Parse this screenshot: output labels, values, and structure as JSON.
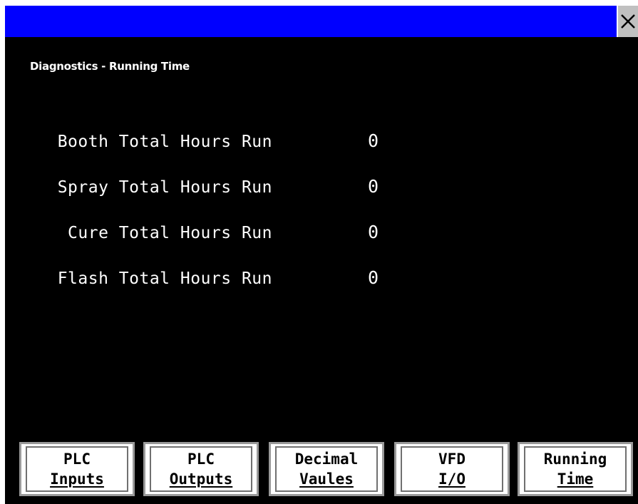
{
  "screen": {
    "title": "Diagnostics - Running Time",
    "close_label": "X"
  },
  "rows": [
    {
      "label": "Booth Total Hours Run",
      "value": "0"
    },
    {
      "label": "Spray Total Hours Run",
      "value": "0"
    },
    {
      "label": "Cure Total Hours Run",
      "value": "0"
    },
    {
      "label": "Flash Total Hours Run",
      "value": "0"
    }
  ],
  "nav": [
    {
      "line1": "PLC",
      "line2": "Inputs"
    },
    {
      "line1": "PLC",
      "line2": "Outputs"
    },
    {
      "line1": "Decimal",
      "line2": "Vaules"
    },
    {
      "line1": "VFD",
      "line2": "I/O"
    },
    {
      "line1": "Running",
      "line2": "Time"
    }
  ],
  "colors": {
    "titlebar": "#0000ff",
    "background": "#000000",
    "text": "#ffffff"
  }
}
